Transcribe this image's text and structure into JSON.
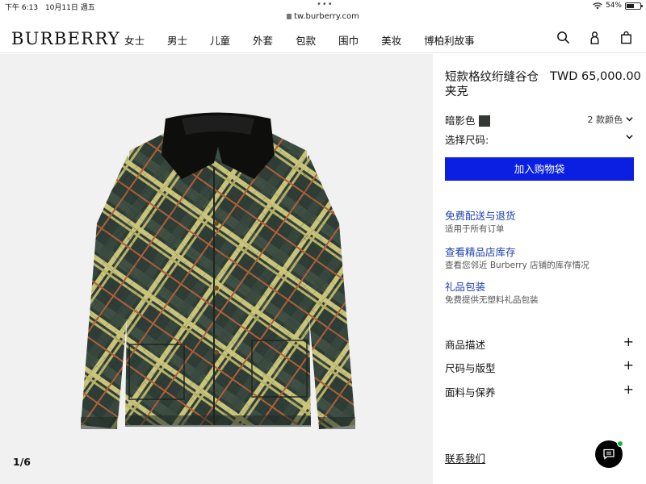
{
  "status_bar": {
    "time": "下午 6:13",
    "date": "10月11日 週五",
    "url": "tw.burberry.com",
    "battery": "54%",
    "battery_level": 0.54
  },
  "header": {
    "logo": "BURBERRY",
    "nav": [
      "女士",
      "男士",
      "儿童",
      "外套",
      "包款",
      "围巾",
      "美妆",
      "博柏利故事"
    ],
    "icons": [
      "search-icon",
      "account-icon",
      "shopping-bag-icon"
    ]
  },
  "gallery": {
    "counter": "1/6"
  },
  "product": {
    "title": "短款格纹绗缝谷仓夹克",
    "price": "TWD 65,000.00",
    "color_label": "暗影色",
    "color_swatch": "#333835",
    "color_count": "2 款颜色",
    "size_label": "选择尺码:",
    "add_to_bag": "加入购物袋"
  },
  "services": [
    {
      "title": "免费配送与退货",
      "subtitle": "适用于所有订单"
    },
    {
      "title": "查看精品店库存",
      "subtitle": "查看您邻近 Burberry 店铺的库存情况"
    },
    {
      "title": "礼品包装",
      "subtitle": "免费提供无塑料礼品包装"
    }
  ],
  "accordions": [
    "商品描述",
    "尺码与版型",
    "面料与保养"
  ],
  "contact": "联系我们",
  "colors": {
    "cta": "#0b1fe3",
    "link": "#1d3fb0",
    "chat_badge": "#1db33a"
  }
}
